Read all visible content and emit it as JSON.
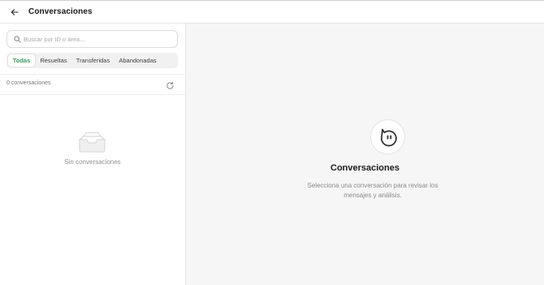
{
  "header": {
    "back_icon": "arrow-left-icon",
    "title": "Conversaciones"
  },
  "sidebar": {
    "search": {
      "placeholder": "Buscar por ID o área...",
      "value": "",
      "icon": "search-icon"
    },
    "tabs": [
      {
        "label": "Todas",
        "active": true
      },
      {
        "label": "Resueltas",
        "active": false
      },
      {
        "label": "Transferidas",
        "active": false
      },
      {
        "label": "Abandonadas",
        "active": false
      }
    ],
    "count_label": "0 conversaciones",
    "refresh_icon": "refresh-icon",
    "empty": {
      "icon": "inbox-icon",
      "text": "Sin conversaciones"
    }
  },
  "main": {
    "logo_icon": "chat-bubble-icon",
    "title": "Conversaciones",
    "description": "Selecciona una conversación para revisar los mensajes y análisis."
  },
  "colors": {
    "accent": "#2fa14f",
    "main_background": "#f6f6f6",
    "text_primary": "#1a1a1a",
    "text_muted": "#8a8a8a"
  }
}
